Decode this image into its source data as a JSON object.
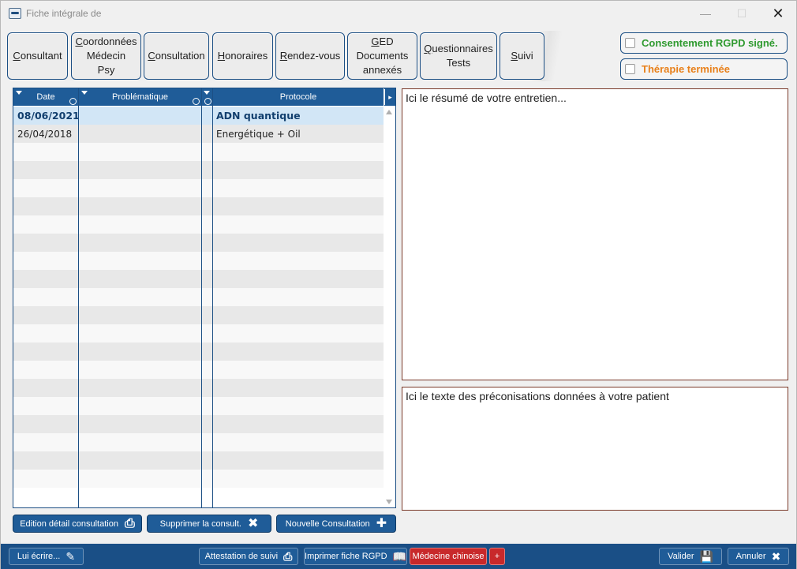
{
  "window": {
    "title": "Fiche intégrale de"
  },
  "tabs": [
    {
      "label_lines": [
        "Consultant"
      ],
      "underline": "C"
    },
    {
      "label_lines": [
        "Coordonnées",
        "Médecin",
        "Psy"
      ],
      "underline": "C"
    },
    {
      "label_lines": [
        "Consultation"
      ],
      "underline": "C"
    },
    {
      "label_lines": [
        "Honoraires"
      ],
      "underline": "H"
    },
    {
      "label_lines": [
        "Rendez-vous"
      ],
      "underline": "R"
    },
    {
      "label_lines": [
        "GED",
        "Documents",
        "annexés"
      ],
      "underline": "G"
    },
    {
      "label_lines": [
        "Questionnaires",
        "Tests"
      ],
      "underline": "Q"
    },
    {
      "label_lines": [
        "Suivi"
      ],
      "underline": "S"
    }
  ],
  "flags": {
    "rgpd": {
      "label": "Consentement RGPD signé.",
      "checked": false,
      "color": "#2f9a2f"
    },
    "therapy": {
      "label": "Thérapie terminée",
      "checked": false,
      "color": "#e8801a"
    }
  },
  "grid": {
    "headers": {
      "date": "Date",
      "problem": "Problématique",
      "protocol": "Protocole"
    },
    "rows": [
      {
        "date": "08/06/2021",
        "problem": "",
        "protocol": "ADN quantique",
        "selected": true
      },
      {
        "date": "26/04/2018",
        "problem": "",
        "protocol": "Energétique + Oil",
        "selected": false
      }
    ],
    "empty_rows": 19
  },
  "memos": {
    "summary": "Ici le résumé de votre entretien...",
    "recommendations": "Ici le texte des préconisations données à votre patient"
  },
  "actions": {
    "edit": "Edition détail consultation",
    "delete": "Supprimer la consult.",
    "new": "Nouvelle Consultation"
  },
  "footer": {
    "write": "Lui écrire...",
    "attestation": "Attestation de suivi",
    "print_rgpd": "Imprimer fiche RGPD",
    "chinese": "Médecine chinoise",
    "plus": "+",
    "validate": "Valider",
    "cancel": "Annuler"
  },
  "colors": {
    "accent": "#1f5c98",
    "footer": "#1a4f86",
    "danger": "#c8292b"
  }
}
